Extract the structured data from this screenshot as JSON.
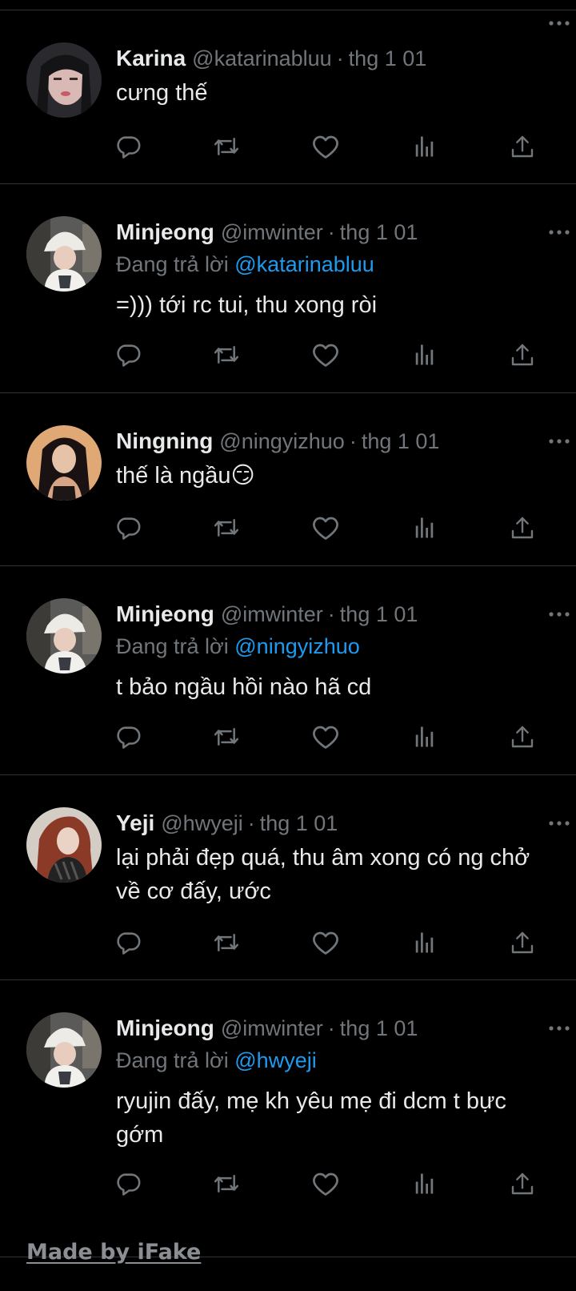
{
  "tweets": [
    {
      "name": "Karina",
      "handle": "@katarinabluu",
      "sep": "·",
      "time": "thg 1 01",
      "replying_prefix": "",
      "replying_to": "",
      "text": "cưng thế",
      "avatar": "karina-avatar"
    },
    {
      "name": "Minjeong",
      "handle": "@imwinter",
      "sep": "·",
      "time": "thg 1 01",
      "replying_prefix": "Đang trả lời ",
      "replying_to": "@katarinabluu",
      "text": "=))) tới rc tui, thu xong ròi",
      "avatar": "minjeong-avatar"
    },
    {
      "name": "Ningning",
      "handle": "@ningyizhuo",
      "sep": "·",
      "time": "thg 1 01",
      "replying_prefix": "",
      "replying_to": "",
      "text": "thế là ngầu😏",
      "avatar": "ningning-avatar"
    },
    {
      "name": "Minjeong",
      "handle": "@imwinter",
      "sep": "·",
      "time": "thg 1 01",
      "replying_prefix": "Đang trả lời ",
      "replying_to": "@ningyizhuo",
      "text": "t bảo ngầu hồi nào hã cd",
      "avatar": "minjeong-avatar"
    },
    {
      "name": "Yeji",
      "handle": "@hwyeji",
      "sep": "·",
      "time": "thg 1 01",
      "replying_prefix": "",
      "replying_to": "",
      "text": "lại phải đẹp quá, thu âm xong có ng chở về cơ đấy, ước",
      "avatar": "yeji-avatar"
    },
    {
      "name": "Minjeong",
      "handle": "@imwinter",
      "sep": "·",
      "time": "thg 1 01",
      "replying_prefix": "Đang trả lời ",
      "replying_to": "@hwyeji",
      "text": "ryujin đấy, mẹ kh yêu mẹ đi dcm t bực gớm",
      "avatar": "minjeong-avatar"
    }
  ],
  "watermark": "Made by iFake",
  "colors": {
    "background": "#000000",
    "text": "#e7e9ea",
    "muted": "#71767b",
    "link": "#1d9bf0",
    "divider": "#2f3336"
  },
  "icons": [
    "more-icon",
    "reply-icon",
    "retweet-icon",
    "like-icon",
    "views-icon",
    "share-icon"
  ]
}
